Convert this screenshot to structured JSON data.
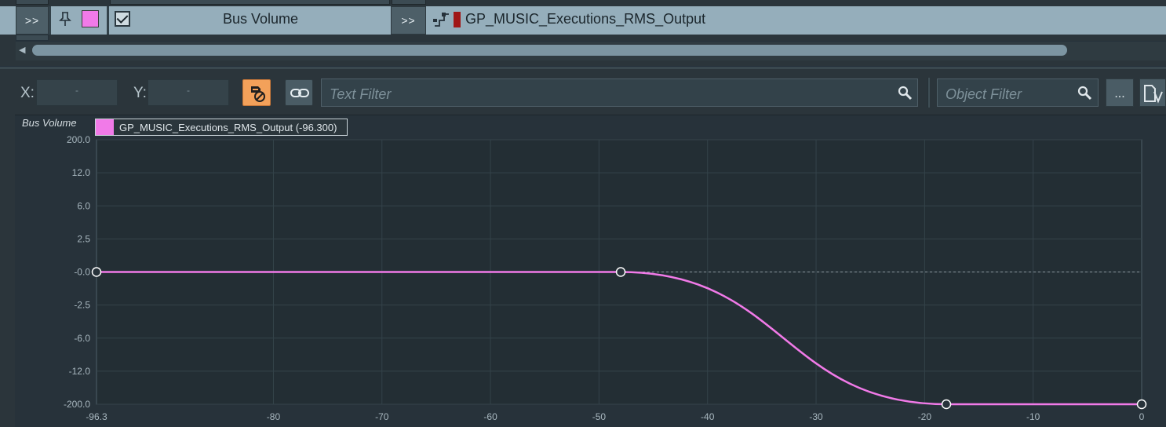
{
  "rtpc_row": {
    "expand_left_label": ">>",
    "expand_right_label": ">>",
    "property_label": "Bus Volume",
    "game_parameter_label": "GP_MUSIC_Executions_RMS_Output",
    "curve_color": "#f17ae8",
    "game_parameter_color": "#a01616",
    "enabled": true
  },
  "toolbar": {
    "x_label": "X:",
    "y_label": "Y:",
    "x_value": "-",
    "y_value": "-",
    "text_filter_placeholder": "Text Filter",
    "object_filter_placeholder": "Object Filter",
    "more_label": "...",
    "bypass_active_color": "#f3a15a"
  },
  "graph": {
    "title": "Bus Volume",
    "legend_label": "GP_MUSIC_Executions_RMS_Output (-96.300)"
  },
  "chart_data": {
    "type": "line",
    "title": "Bus Volume",
    "x_tick_labels": [
      "-96.3",
      "-80",
      "-70",
      "-60",
      "-50",
      "-40",
      "-30",
      "-20",
      "-10",
      "0"
    ],
    "y_tick_labels": [
      "200.0",
      "12.0",
      "6.0",
      "2.5",
      "-0.0",
      "-2.5",
      "-6.0",
      "-12.0",
      "-200.0"
    ],
    "xlim": [
      -96.3,
      0
    ],
    "ylim": [
      -200,
      200
    ],
    "reference_line_y": 0,
    "series": [
      {
        "name": "GP_MUSIC_Executions_RMS_Output",
        "color": "#f17ae8",
        "points": [
          {
            "x": -96.3,
            "y": 0,
            "label": "-0.0"
          },
          {
            "x": -48,
            "y": 0,
            "label": "-0.0"
          },
          {
            "x": -18,
            "y": -200,
            "label": "-200.0"
          },
          {
            "x": 0,
            "y": -200,
            "label": "-200.0"
          }
        ],
        "curve": "scurve between points 2 and 3"
      }
    ]
  }
}
